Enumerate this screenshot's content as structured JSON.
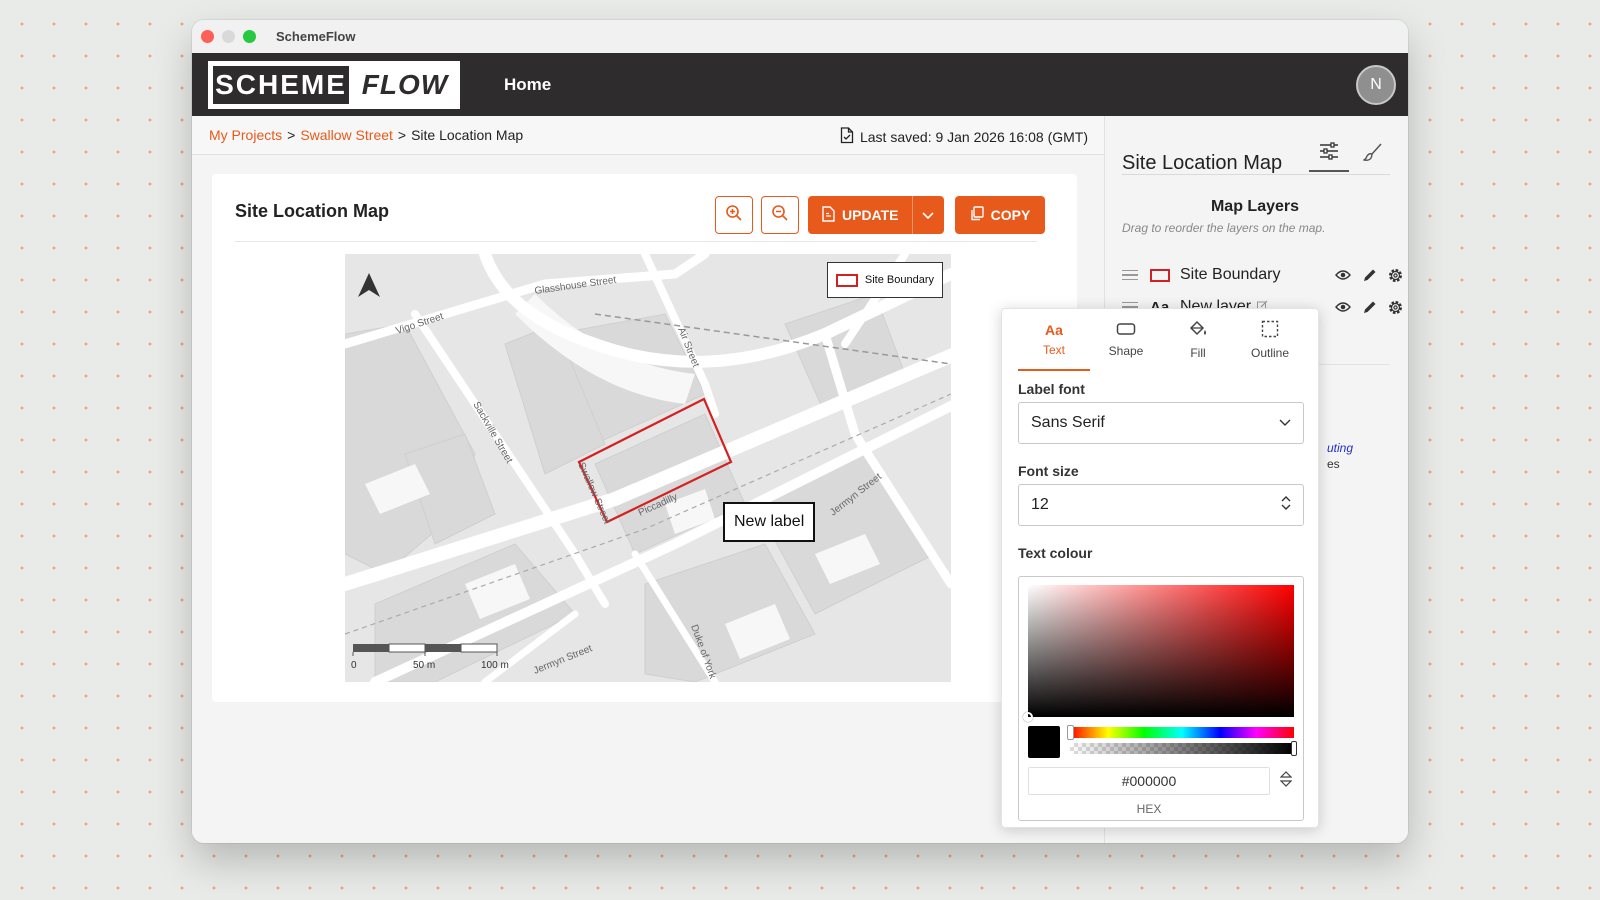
{
  "window": {
    "title": "SchemeFlow"
  },
  "nav": {
    "logo_left": "SCHEME",
    "logo_right": "FLOW",
    "home": "Home",
    "avatar_initial": "N"
  },
  "breadcrumb": {
    "items": [
      "My Projects",
      "Swallow Street",
      "Site Location Map"
    ],
    "separator": ">",
    "last_saved": "Last saved: 9 Jan 2026 16:08 (GMT)"
  },
  "card": {
    "title": "Site Location Map",
    "update_label": "UPDATE",
    "copy_label": "COPY"
  },
  "map": {
    "legend_label": "Site Boundary",
    "label_text": "New label",
    "streets": [
      "Glasshouse Street",
      "Vigo Street",
      "Air Street",
      "Sackville Street",
      "Swallow Street",
      "Piccadilly",
      "Jermyn Street",
      "Jermyn Street",
      "Duke of York"
    ],
    "scale_labels": [
      "0",
      "50 m",
      "100 m"
    ],
    "boundary_color": "#d42020"
  },
  "sidebar": {
    "title": "Site Location Map",
    "layers_title": "Map Layers",
    "layers_hint": "Drag to reorder the layers on the map.",
    "layers": [
      {
        "name": "Site Boundary",
        "icon": "rect-outline-icon"
      },
      {
        "name": "New layer",
        "icon": "text-aa-icon"
      }
    ],
    "peek_line1": "uting",
    "peek_line2": "es"
  },
  "popover": {
    "tabs": [
      "Text",
      "Shape",
      "Fill",
      "Outline"
    ],
    "active_tab": "Text",
    "label_font_label": "Label font",
    "label_font_value": "Sans Serif",
    "font_size_label": "Font size",
    "font_size_value": "12",
    "text_colour_label": "Text colour",
    "hex_value": "#000000",
    "hex_caption": "HEX"
  },
  "colors": {
    "accent": "#e85a1b",
    "nav_bg": "#2e2c2c",
    "link": "#e85a1b"
  }
}
